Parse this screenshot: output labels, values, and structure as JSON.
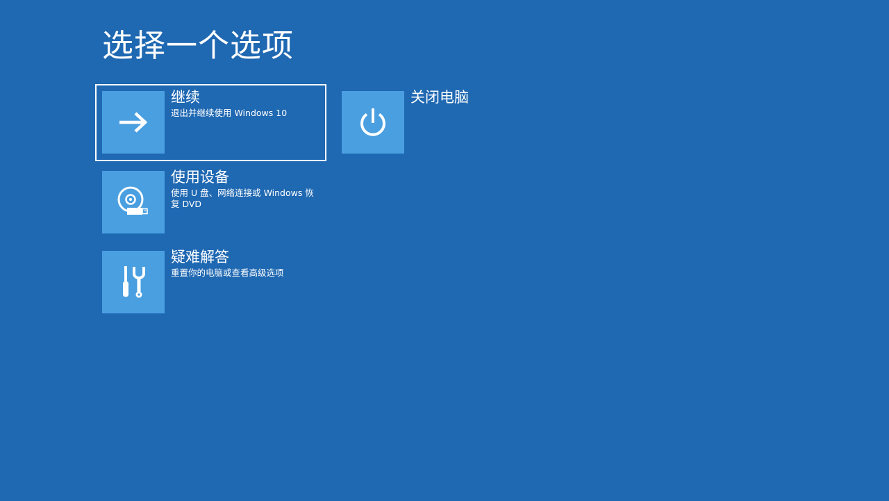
{
  "page": {
    "title": "选择一个选项"
  },
  "options": {
    "continue": {
      "title": "继续",
      "description": "退出并继续使用 Windows 10",
      "icon": "arrow-right-icon",
      "focused": true
    },
    "use_device": {
      "title": "使用设备",
      "description": "使用 U 盘、网络连接或 Windows 恢复 DVD",
      "icon": "disc-usb-icon"
    },
    "troubleshoot": {
      "title": "疑难解答",
      "description": "重置你的电脑或查看高级选项",
      "icon": "tools-icon"
    },
    "shutdown": {
      "title": "关闭电脑",
      "icon": "power-icon"
    }
  },
  "colors": {
    "background": "#1f68b2",
    "tile": "#4a9fe0",
    "text": "#ffffff"
  }
}
